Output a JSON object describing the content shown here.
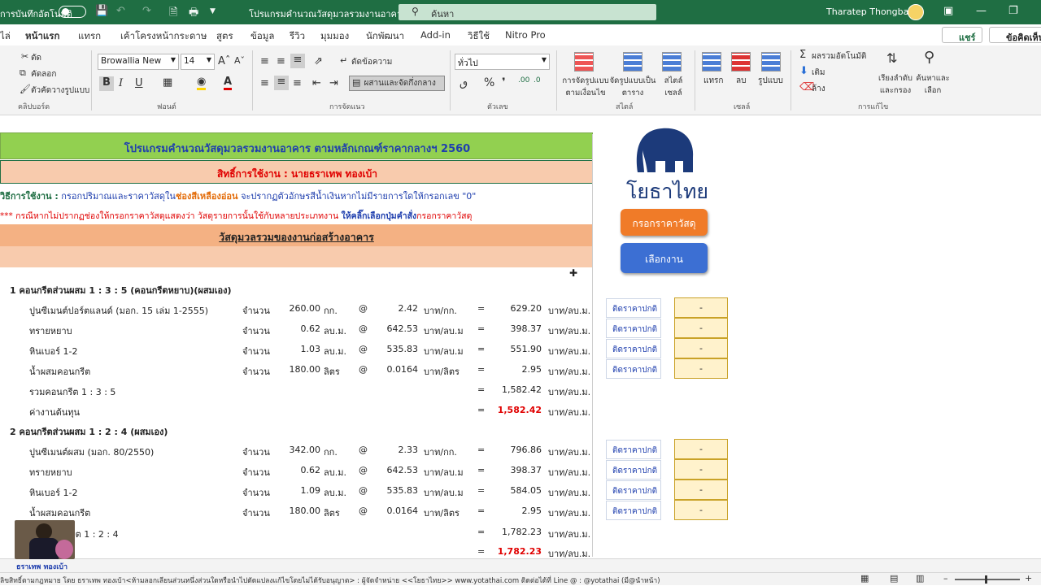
{
  "titlebar": {
    "autosave": "การบันทึกอัตโนมัติ",
    "doc_title": "โปรแกรมคำนวณวัสดุมวลรวมงานอาคาร",
    "search_placeholder": "ค้นหา",
    "user": "Tharatep Thongbao"
  },
  "menu": {
    "tabs": [
      "ไล่",
      "หน้าแรก",
      "แทรก",
      "เค้าโครงหน้ากระดาษ",
      "สูตร",
      "ข้อมูล",
      "รีวิว",
      "มุมมอง",
      "นักพัฒนา",
      "Add-in",
      "วิธีใช้",
      "Nitro Pro"
    ],
    "share": "แชร์",
    "comments": "ข้อคิดเห็น"
  },
  "ribbon": {
    "cut": "ตัด",
    "copy": "คัดลอก",
    "format_painter": "ตัวคัดวางรูปแบบ",
    "clipboard_group": "คลิปบอร์ด",
    "font_name": "Browallia New",
    "font_size": "14",
    "font_group": "ฟอนต์",
    "wrap_text": "ตัดข้อความ",
    "merge_center": "ผสานและจัดกึ่งกลาง",
    "alignment_group": "การจัดแนว",
    "number_format": "ทั่วไป",
    "number_group": "ตัวเลข",
    "cond_format": "การจัดรูปแบบ ตามเงื่อนไข",
    "format_table": "จัดรูปแบบเป็น ตาราง",
    "cell_styles": "สไตล์ เซลล์",
    "styles_group": "สไตล์",
    "insert": "แทรก",
    "delete": "ลบ",
    "format": "รูปแบบ",
    "cells_group": "เซลล์",
    "autosum": "ผลรวมอัตโนมัติ",
    "fill": "เติม",
    "clear": "ล้าง",
    "sort_filter": "เรียงลำดับ และกรอง",
    "find_select": "ค้นหาและ เลือก",
    "editing_group": "การแก้ไข"
  },
  "sheet": {
    "title": "โปรแกรมคำนวณวัสดุมวลรวมงานอาคาร ตามหลักเกณฑ์ราคากลางฯ 2560",
    "license": "สิทธิ์การใช้งาน : นายธราเทพ ทองเบ้า",
    "howto_label": "วิธีการใช้งาน :",
    "howto_a": "กรอกปริมาณและราคาวัสดุใน",
    "howto_b": "ช่องสีเหลืองอ่อน",
    "howto_c": "จะปรากฏตัวอักษรสีน้ำเงินหากไม่มีรายการใดให้กรอกเลข \"0\"",
    "note_a": "*** กรณีหากไม่ปรากฏช่องให้กรอกราคาวัสดุแสดงว่า วัสดุรายการนั้นใช้กับหลายประเภทงาน",
    "note_b": "ให้คลิ๊กเลือกปุ่มคำสั่ง",
    "note_c": "กรอกราคาวัสดุ",
    "section": "วัสดุมวลรวมของงานก่อสร้างอาคาร",
    "logo": "โยธาไทย",
    "btn_price": "กรอกราคาวัสดุ",
    "btn_select": "เลือกงาน",
    "link_label": "ติดราคาปกติ",
    "dash": "-",
    "groups": [
      {
        "title": "1  คอนกรีตส่วนผสม 1 : 3 : 5 (คอนกรีตหยาบ)(ผสมเอง)",
        "items": [
          {
            "name": "ปูนซีเมนต์ปอร์ตแลนด์ (มอก. 15 เล่ม 1-2555)",
            "qty_label": "จำนวน",
            "qty": "260.00",
            "unit": "กก.",
            "at": "@",
            "price": "2.42",
            "price_unit": "บาท/กก.",
            "eq": "=",
            "total": "629.20",
            "total_unit": "บาท/ลบ.ม."
          },
          {
            "name": "ทรายหยาบ",
            "qty_label": "จำนวน",
            "qty": "0.62",
            "unit": "ลบ.ม.",
            "at": "@",
            "price": "642.53",
            "price_unit": "บาท/ลบ.ม",
            "eq": "=",
            "total": "398.37",
            "total_unit": "บาท/ลบ.ม."
          },
          {
            "name": "หินเบอร์ 1-2",
            "qty_label": "จำนวน",
            "qty": "1.03",
            "unit": "ลบ.ม.",
            "at": "@",
            "price": "535.83",
            "price_unit": "บาท/ลบ.ม",
            "eq": "=",
            "total": "551.90",
            "total_unit": "บาท/ลบ.ม."
          },
          {
            "name": "น้ำผสมคอนกรีต",
            "qty_label": "จำนวน",
            "qty": "180.00",
            "unit": "ลิตร",
            "at": "@",
            "price": "0.0164",
            "price_unit": "บาท/ลิตร",
            "eq": "=",
            "total": "2.95",
            "total_unit": "บาท/ลบ.ม."
          }
        ],
        "sum_label": "รวมคอนกรีต  1 : 3 : 5",
        "sum_eq": "=",
        "sum": "1,582.42",
        "sum_unit": "บาท/ลบ.ม.",
        "cost_label": "ค่างานต้นทุน",
        "cost_eq": "=",
        "cost": "1,582.42",
        "cost_unit": "บาท/ลบ.ม."
      },
      {
        "title": "2  คอนกรีตส่วนผสม 1 : 2 : 4 (ผสมเอง)",
        "items": [
          {
            "name": "ปูนซีเมนต์ผสม (มอก. 80/2550)",
            "qty_label": "จำนวน",
            "qty": "342.00",
            "unit": "กก.",
            "at": "@",
            "price": "2.33",
            "price_unit": "บาท/กก.",
            "eq": "=",
            "total": "796.86",
            "total_unit": "บาท/ลบ.ม."
          },
          {
            "name": "ทรายหยาบ",
            "qty_label": "จำนวน",
            "qty": "0.62",
            "unit": "ลบ.ม.",
            "at": "@",
            "price": "642.53",
            "price_unit": "บาท/ลบ.ม",
            "eq": "=",
            "total": "398.37",
            "total_unit": "บาท/ลบ.ม."
          },
          {
            "name": "หินเบอร์ 1-2",
            "qty_label": "จำนวน",
            "qty": "1.09",
            "unit": "ลบ.ม.",
            "at": "@",
            "price": "535.83",
            "price_unit": "บาท/ลบ.ม",
            "eq": "=",
            "total": "584.05",
            "total_unit": "บาท/ลบ.ม."
          },
          {
            "name": "น้ำผสมคอนกรีต",
            "qty_label": "จำนวน",
            "qty": "180.00",
            "unit": "ลิตร",
            "at": "@",
            "price": "0.0164",
            "price_unit": "บาท/ลิตร",
            "eq": "=",
            "total": "2.95",
            "total_unit": "บาท/ลบ.ม."
          }
        ],
        "sum_label": "กรีต  1 : 2 : 4",
        "sum_eq": "=",
        "sum": "1,782.23",
        "sum_unit": "บาท/ลบ.ม.",
        "cost_eq": "=",
        "cost": "1,782.23",
        "cost_unit": "บาท/ลบ.ม."
      }
    ]
  },
  "webcam_caption": "ธราเทพ ทองเบ้า",
  "status_text": "ลิขสิทธิ์ตามกฎหมาย  โดย  ธราเทพ  ทองเบ้า<ห้ามลอกเลียนส่วนหนึ่งส่วนใดหรือนำไปดัดแปลงแก้ไขโดยไม่ได้รับอนุญาต>  :  ผู้จัดจำหน่าย  <<โยธาไทย>>  www.yotathai.com ติดต่อได้ที่  Line @ : @yotathai (มี@นำหน้า)",
  "colors": {
    "title_green": "#1f6e43",
    "banner_green": "#92d050",
    "banner_peach": "#f8cbad",
    "section_orange": "#f4b183",
    "yellow": "#fff2cc",
    "red": "#e00000",
    "blue": "#1f3fae"
  }
}
